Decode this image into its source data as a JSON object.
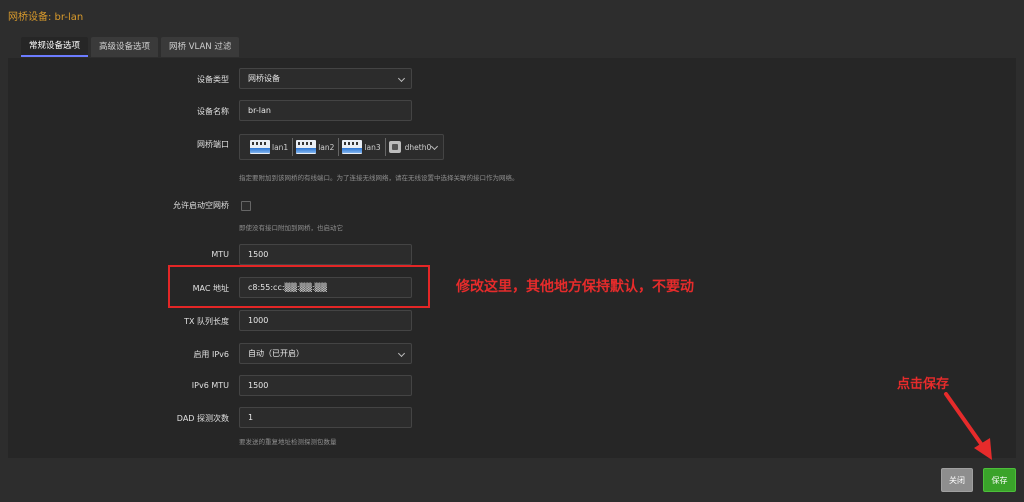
{
  "dialog": {
    "title": "网桥设备: br-lan",
    "tabs": [
      "常规设备选项",
      "高级设备选项",
      "网桥 VLAN 过滤"
    ]
  },
  "form": {
    "device_type": {
      "label": "设备类型",
      "value": "网桥设备"
    },
    "device_name": {
      "label": "设备名称",
      "value": "br-lan"
    },
    "bridge_ports": {
      "label": "网桥端口",
      "ports": [
        "lan1",
        "lan2",
        "lan3"
      ],
      "extra": "dheth0",
      "hint": "指定要附加到该网桥的有线端口。为了连接无线网络，请在无线设置中选择关联的接口作为网络。"
    },
    "empty_bridge": {
      "label": "允许启动空网桥",
      "hint": "即使没有接口附加到网桥，也启动它"
    },
    "mtu": {
      "label": "MTU",
      "value": "1500"
    },
    "mac": {
      "label": "MAC 地址",
      "value": "c8:55:cc:▒▒:▒▒:▒▒"
    },
    "txqueuelen": {
      "label": "TX 队列长度",
      "value": "1000"
    },
    "ipv6": {
      "label": "启用 IPv6",
      "value": "自动（已开启）"
    },
    "ipv6_mtu": {
      "label": "IPv6 MTU",
      "value": "1500"
    },
    "dad": {
      "label": "DAD 探测次数",
      "value": "1",
      "hint": "要发送的重复地址检测探测包数量"
    }
  },
  "annotations": {
    "modify_here": "修改这里，其他地方保持默认，不要动",
    "click_save": "点击保存",
    "color": "#e62b2b"
  },
  "footer": {
    "close_label": "关闭",
    "save_label": "保存"
  }
}
